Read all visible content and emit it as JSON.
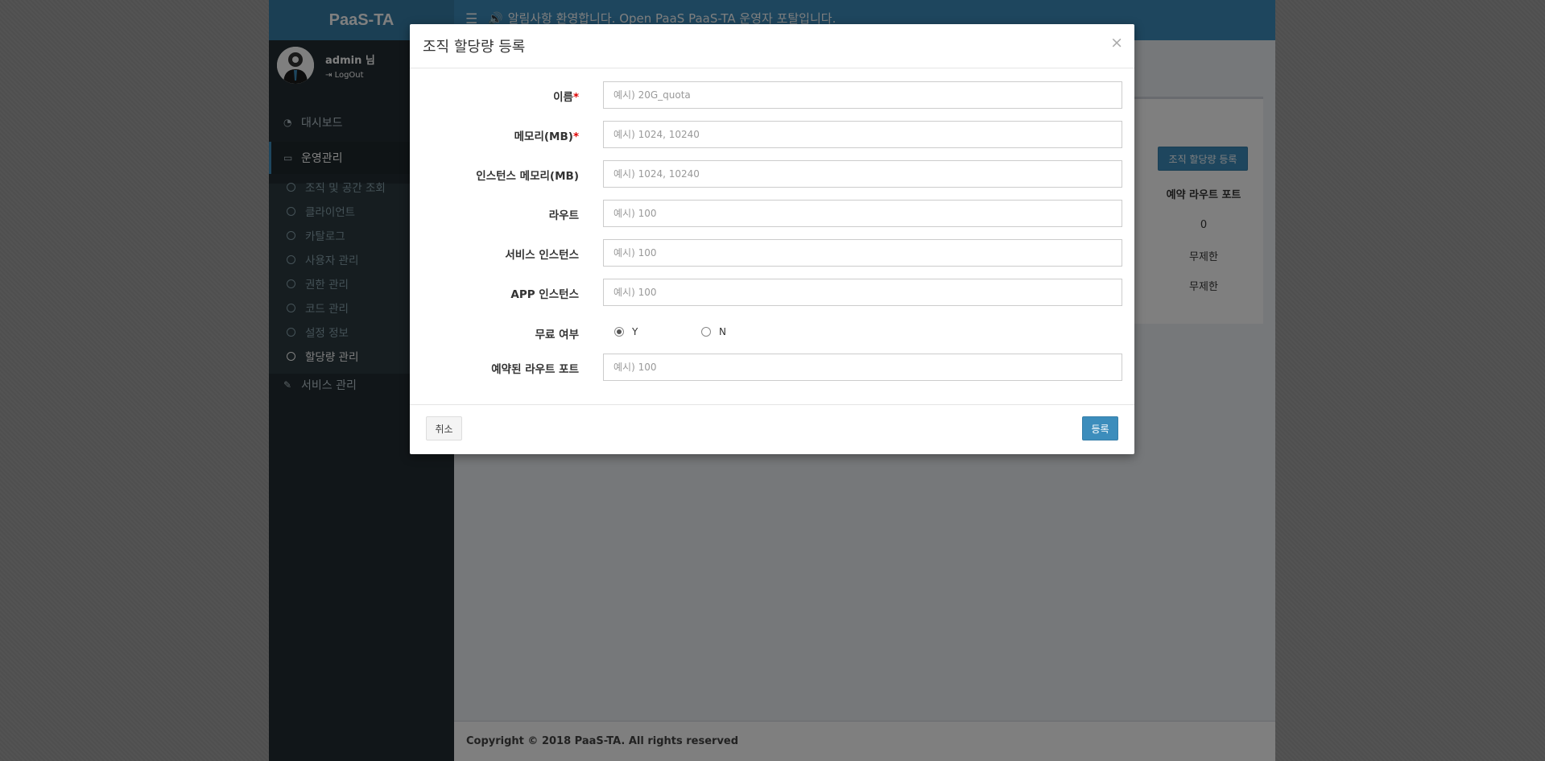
{
  "app": {
    "logo": "PaaS-TA",
    "notice": "알림사항 환영합니다. Open PaaS PaaS-TA 운영자 포탈입니다.",
    "user_name": "admin 님",
    "logout": "LogOut"
  },
  "sidebar": {
    "items": [
      {
        "label": "대시보드",
        "icon": "dashboard-icon"
      },
      {
        "label": "운영관리",
        "icon": "laptop-icon"
      },
      {
        "label": "서비스 관리",
        "icon": "edit-icon"
      }
    ],
    "sub_items": [
      {
        "label": "조직 및 공간 조회"
      },
      {
        "label": "클라이언트"
      },
      {
        "label": "카탈로그"
      },
      {
        "label": "사용자 관리"
      },
      {
        "label": "권한 관리"
      },
      {
        "label": "코드 관리"
      },
      {
        "label": "설정 정보"
      },
      {
        "label": "할당량 관리"
      }
    ]
  },
  "background": {
    "register_button": "조직 할당량 등록",
    "column_header": "예약 라우트 포트",
    "cells": [
      "0",
      "무제한",
      "무제한"
    ]
  },
  "footer": "Copyright © 2018 PaaS-TA. All rights reserved",
  "modal": {
    "title": "조직 할당량 등록",
    "close": "×",
    "fields": [
      {
        "label": "이름",
        "required": "*",
        "placeholder": "예시) 20G_quota"
      },
      {
        "label": "메모리(MB)",
        "required": "*",
        "placeholder": "예시) 1024, 10240"
      },
      {
        "label": "인스턴스 메모리(MB)",
        "required": "",
        "placeholder": "예시) 1024, 10240"
      },
      {
        "label": "라우트",
        "required": "",
        "placeholder": "예시) 100"
      },
      {
        "label": "서비스 인스턴스",
        "required": "",
        "placeholder": "예시) 100"
      },
      {
        "label": "APP 인스턴스",
        "required": "",
        "placeholder": "예시) 100"
      }
    ],
    "free": {
      "label": "무료 여부",
      "option_y": "Y",
      "option_n": "N",
      "selected": "Y"
    },
    "reserved": {
      "label": "예약된 라우트 포트",
      "placeholder": "예시) 100"
    },
    "cancel": "취소",
    "submit": "등록"
  },
  "colors": {
    "primary": "#3c8dbc",
    "sidebar": "#222d32",
    "required": "#dd0000"
  }
}
